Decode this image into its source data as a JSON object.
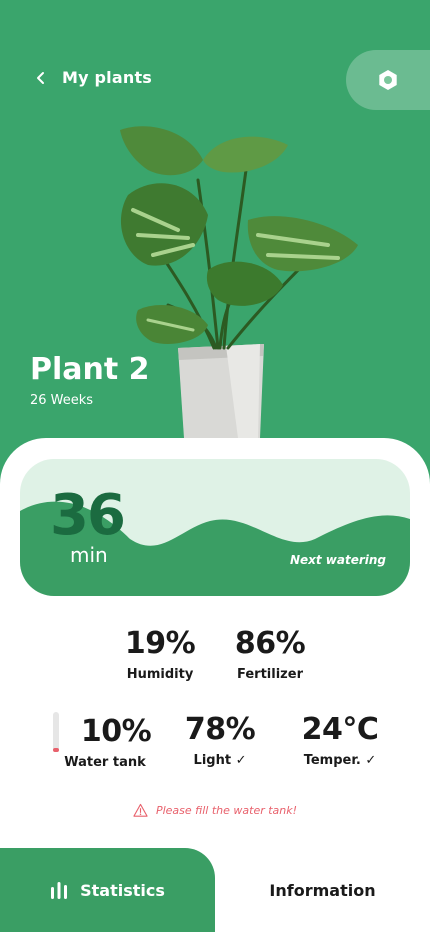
{
  "nav": {
    "back_label": "My plants"
  },
  "plant": {
    "name": "Plant 2",
    "age": "26 Weeks"
  },
  "watering": {
    "value": "36",
    "unit": "min",
    "label": "Next watering"
  },
  "stats_top": [
    {
      "value": "19%",
      "label": "Humidity"
    },
    {
      "value": "86%",
      "label": "Fertilizer"
    }
  ],
  "stats_bottom": [
    {
      "value": "10%",
      "label": "Water tank",
      "level": 0.1
    },
    {
      "value": "78%",
      "label": "Light ✓"
    },
    {
      "value": "24°C",
      "label": "Temper. ✓"
    }
  ],
  "warning": "Please fill the water tank!",
  "tabs": [
    {
      "label": "Statistics",
      "icon": "bar-chart-icon",
      "active": true
    },
    {
      "label": "Information",
      "active": false
    }
  ],
  "colors": {
    "brand": "#3aa56c",
    "light": "#dff2e6",
    "warning": "#e8616c"
  }
}
